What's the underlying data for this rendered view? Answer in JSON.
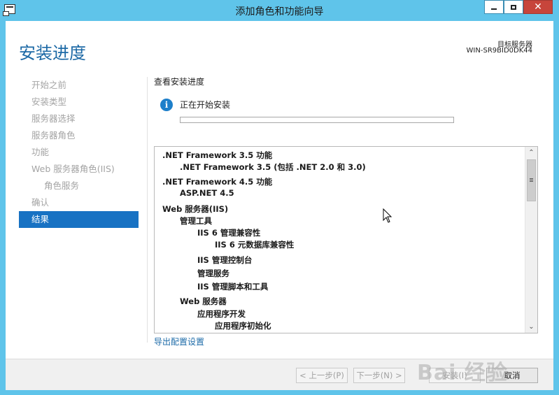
{
  "window": {
    "title": "添加角色和功能向导",
    "close_glyph": "✕"
  },
  "header": {
    "page_title": "安装进度",
    "destination_label": "目标服务器",
    "destination_server": "WIN-SR9BID0DK44"
  },
  "nav": {
    "items": [
      {
        "label": "开始之前",
        "state": "disabled"
      },
      {
        "label": "安装类型",
        "state": "disabled"
      },
      {
        "label": "服务器选择",
        "state": "disabled"
      },
      {
        "label": "服务器角色",
        "state": "disabled"
      },
      {
        "label": "功能",
        "state": "disabled"
      },
      {
        "label": "Web 服务器角色(IIS)",
        "state": "disabled"
      },
      {
        "label": "角色服务",
        "state": "disabled"
      },
      {
        "label": "确认",
        "state": "disabled"
      },
      {
        "label": "结果",
        "state": "active"
      }
    ]
  },
  "content": {
    "section_title": "查看安装进度",
    "status_text": "正在开始安装",
    "info_glyph": "i",
    "progress_fraction": 0,
    "results": [
      {
        "label": ".NET Framework 3.5 功能"
      },
      {
        "label": ".NET Framework 3.5 (包括 .NET 2.0 和 3.0)"
      },
      {
        "label": ".NET Framework 4.5 功能"
      },
      {
        "label": "ASP.NET 4.5"
      },
      {
        "label": "Web 服务器(IIS)"
      },
      {
        "label": "管理工具"
      },
      {
        "label": "IIS 6 管理兼容性"
      },
      {
        "label": "IIS 6 元数据库兼容性"
      },
      {
        "label": "IIS 管理控制台"
      },
      {
        "label": "管理服务"
      },
      {
        "label": "IIS 管理脚本和工具"
      },
      {
        "label": "Web 服务器"
      },
      {
        "label": "应用程序开发"
      },
      {
        "label": "应用程序初始化"
      }
    ],
    "export_link": "导出配置设置"
  },
  "footer": {
    "previous_label": "< 上一步(P)",
    "next_label": "下一步(N) >",
    "install_label": "安装(I)",
    "cancel_label": "取消"
  },
  "watermark": "Bai 经验",
  "icons": {
    "info": "info-icon",
    "app": "app-icon",
    "minimize": "minimize-icon",
    "maximize": "maximize-icon",
    "close": "close-icon"
  },
  "colors": {
    "titlebar": "#5fc4ea",
    "accent": "#1872c3",
    "page_title": "#1e6aa6",
    "close_button": "#c7453b"
  }
}
